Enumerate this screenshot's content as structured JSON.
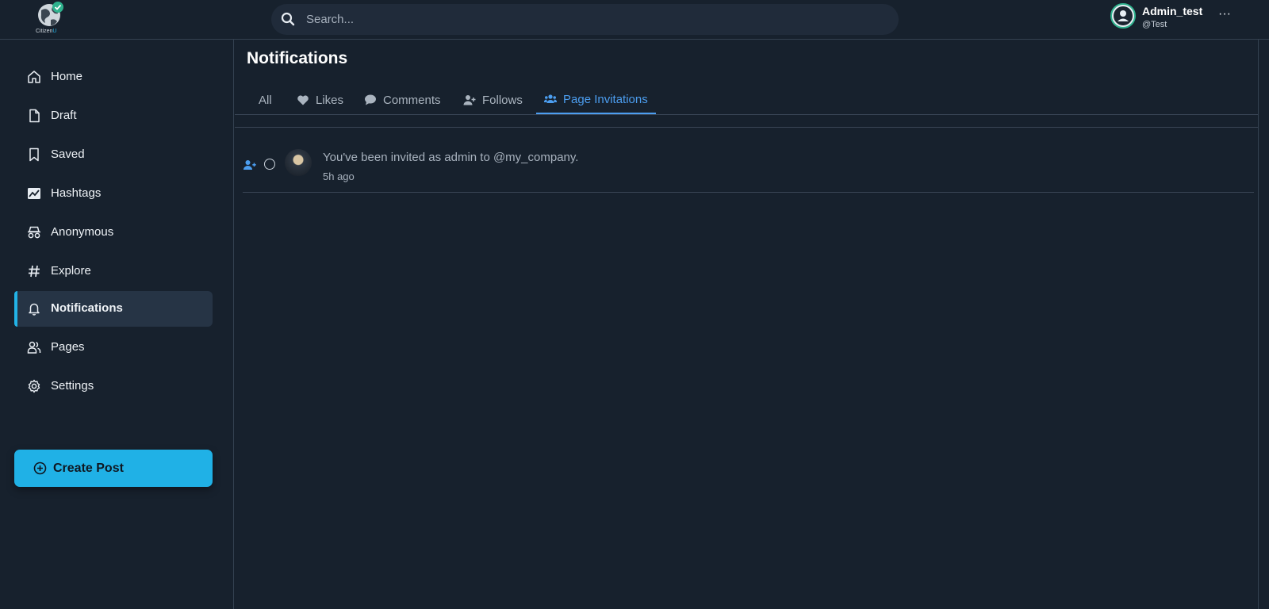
{
  "brand": {
    "logo_text": "Citizen",
    "logo_text_accent": "U"
  },
  "search": {
    "placeholder": "Search..."
  },
  "user": {
    "name": "Admin_test",
    "handle": "@Test",
    "more_label": "···"
  },
  "sidebar": {
    "items": [
      {
        "label": "Home",
        "icon": "home-icon"
      },
      {
        "label": "Draft",
        "icon": "file-icon"
      },
      {
        "label": "Saved",
        "icon": "bookmark-icon"
      },
      {
        "label": "Hashtags",
        "icon": "trend-chart-icon"
      },
      {
        "label": "Anonymous",
        "icon": "incognito-icon"
      },
      {
        "label": "Explore",
        "icon": "hash-icon"
      },
      {
        "label": "Notifications",
        "icon": "bell-icon",
        "active": true
      },
      {
        "label": "Pages",
        "icon": "users-icon"
      },
      {
        "label": "Settings",
        "icon": "gear-icon"
      }
    ],
    "create_post_label": "Create Post"
  },
  "main": {
    "title": "Notifications",
    "tabs": [
      {
        "label": "All"
      },
      {
        "label": "Likes",
        "icon": "heart-icon"
      },
      {
        "label": "Comments",
        "icon": "comment-icon"
      },
      {
        "label": "Follows",
        "icon": "user-plus-icon"
      },
      {
        "label": "Page Invitations",
        "icon": "user-group-icon",
        "active": true
      }
    ],
    "notifications": [
      {
        "message": "You've been invited as admin to @my_company.",
        "time": "5h ago",
        "icon": "user-plus-icon"
      }
    ]
  },
  "colors": {
    "background": "#17212d",
    "accent": "#20b1e6",
    "active_tab": "#4c9ef0",
    "sidebar_active": "#263445"
  }
}
